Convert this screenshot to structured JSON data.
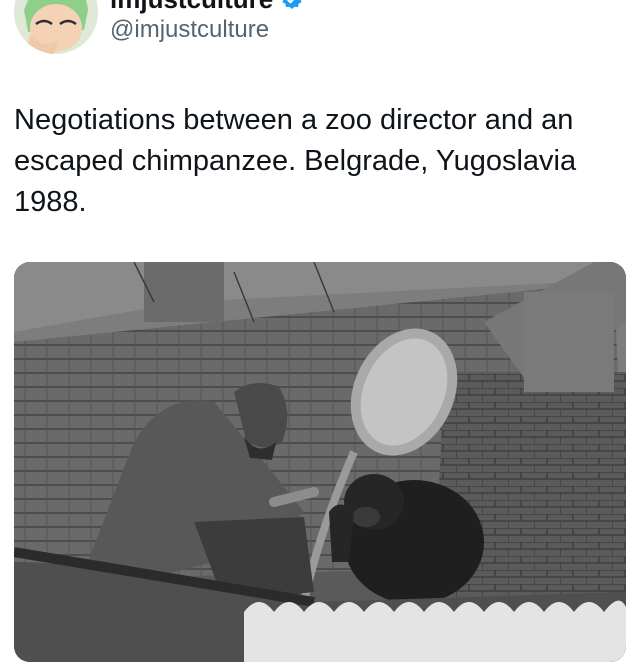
{
  "tweet": {
    "display_name": "imjustculture",
    "handle": "@imjustculture",
    "verified": true,
    "text_lines": [
      "Negotiations between a zoo director and an",
      "escaped chimpanzee. Belgrade, Yugoslavia",
      "1988."
    ]
  },
  "icons": {
    "verified": "verified-badge-icon"
  },
  "colors": {
    "verified_badge": "#1d9bf0",
    "handle_text": "#536471",
    "body_text": "#0f1419"
  }
}
